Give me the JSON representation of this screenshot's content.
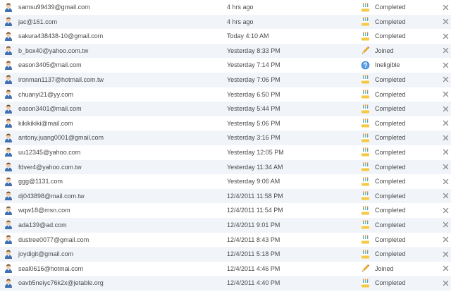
{
  "invites": [
    {
      "email": "samsu99439@gmail.com",
      "time": "4 hrs ago",
      "status": "Completed",
      "status_icon": "reward-cake-icon"
    },
    {
      "email": "jac@161.com",
      "time": "4 hrs ago",
      "status": "Completed",
      "status_icon": "reward-cake-icon"
    },
    {
      "email": "sakura438438-10@gmail.com",
      "time": "Today 4:10 AM",
      "status": "Completed",
      "status_icon": "reward-cake-icon"
    },
    {
      "email": "b_box40@yahoo.com.tw",
      "time": "Yesterday 8:33 PM",
      "status": "Joined",
      "status_icon": "pencil-icon"
    },
    {
      "email": "eason3405@mail.com",
      "time": "Yesterday 7:14 PM",
      "status": "Ineligible",
      "status_icon": "question-icon"
    },
    {
      "email": "ironman1137@hotmail.com.tw",
      "time": "Yesterday 7:06 PM",
      "status": "Completed",
      "status_icon": "reward-cake-icon"
    },
    {
      "email": "chuanyi21@yy.com",
      "time": "Yesterday 6:50 PM",
      "status": "Completed",
      "status_icon": "reward-cake-icon"
    },
    {
      "email": "eason3401@mail.com",
      "time": "Yesterday 5:44 PM",
      "status": "Completed",
      "status_icon": "reward-cake-icon"
    },
    {
      "email": "kikikikiki@mail.com",
      "time": "Yesterday 5:06 PM",
      "status": "Completed",
      "status_icon": "reward-cake-icon"
    },
    {
      "email": "antony.juang0001@gmail.com",
      "time": "Yesterday 3:16 PM",
      "status": "Completed",
      "status_icon": "reward-cake-icon"
    },
    {
      "email": "uu12345@yahoo.com",
      "time": "Yesterday 12:05 PM",
      "status": "Completed",
      "status_icon": "reward-cake-icon"
    },
    {
      "email": "fdver4@yahoo.com.tw",
      "time": "Yesterday 11:34 AM",
      "status": "Completed",
      "status_icon": "reward-cake-icon"
    },
    {
      "email": "ggg@1131.com",
      "time": "Yesterday 9:06 AM",
      "status": "Completed",
      "status_icon": "reward-cake-icon"
    },
    {
      "email": "dj043898@mail.com.tw",
      "time": "12/4/2011 11:58 PM",
      "status": "Completed",
      "status_icon": "reward-cake-icon"
    },
    {
      "email": "wqw18@msn.com",
      "time": "12/4/2011 11:54 PM",
      "status": "Completed",
      "status_icon": "reward-cake-icon"
    },
    {
      "email": "ada139@ad.com",
      "time": "12/4/2011 9:01 PM",
      "status": "Completed",
      "status_icon": "reward-cake-icon"
    },
    {
      "email": "dustree0077@gmail.com",
      "time": "12/4/2011 8:43 PM",
      "status": "Completed",
      "status_icon": "reward-cake-icon"
    },
    {
      "email": "joydigit@gmail.com",
      "time": "12/4/2011 5:18 PM",
      "status": "Completed",
      "status_icon": "reward-cake-icon"
    },
    {
      "email": "seal0616@hotmai.com",
      "time": "12/4/2011 4:46 PM",
      "status": "Joined",
      "status_icon": "pencil-icon"
    },
    {
      "email": "oavb5neiyc76k2x@jetable.org",
      "time": "12/4/2011 4:40 PM",
      "status": "Completed",
      "status_icon": "reward-cake-icon"
    }
  ],
  "icons": {
    "avatar": "user-avatar-icon",
    "remove": "remove-x-icon"
  },
  "colors": {
    "row_alt_bg": "#f1f5fa",
    "text": "#4a4a4a",
    "avatar_shirt": "#3f6fb0",
    "avatar_face": "#f2c9a0",
    "cake": "#f6c945",
    "cake_candle": "#5aa0d6",
    "pencil": "#e8a830",
    "question": "#3f86d0",
    "remove_x": "#8f8f8f"
  }
}
